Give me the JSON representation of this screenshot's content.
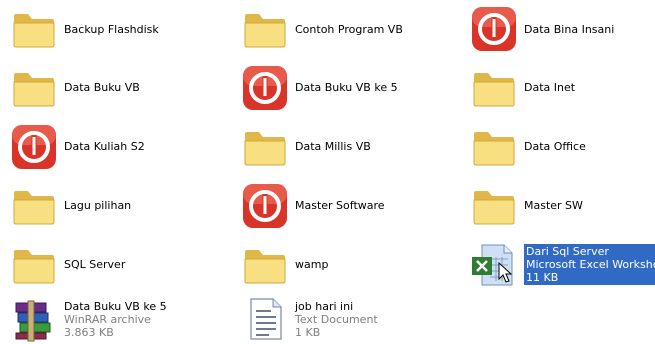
{
  "items": [
    {
      "name": "Backup Flashdisk",
      "icon": "folder-icon"
    },
    {
      "name": "Contoh Program VB",
      "icon": "folder-icon"
    },
    {
      "name": "Data Bina Insani",
      "icon": "red-power-icon"
    },
    {
      "name": "Data Buku VB",
      "icon": "folder-icon"
    },
    {
      "name": "Data Buku VB ke 5",
      "icon": "red-power-icon"
    },
    {
      "name": "Data Inet",
      "icon": "folder-icon"
    },
    {
      "name": "Data Kuliah S2",
      "icon": "red-power-icon"
    },
    {
      "name": "Data Millis VB",
      "icon": "folder-icon"
    },
    {
      "name": "Data Office",
      "icon": "folder-icon"
    },
    {
      "name": "Lagu pilihan",
      "icon": "folder-icon"
    },
    {
      "name": "Master Software",
      "icon": "red-power-icon"
    },
    {
      "name": "Master SW",
      "icon": "folder-icon"
    },
    {
      "name": "SQL Server",
      "icon": "folder-icon"
    },
    {
      "name": "wamp",
      "icon": "folder-icon"
    },
    {
      "name": "Dari Sql Server",
      "type": "Microsoft Excel Worksheet",
      "size": "11 KB",
      "icon": "excel-file-icon",
      "selected": true
    },
    {
      "name": "Data Buku VB ke 5",
      "type": "WinRAR archive",
      "size": "3.863 KB",
      "icon": "winrar-archive-icon"
    },
    {
      "name": "job hari ini",
      "type": "Text Document",
      "size": "1 KB",
      "icon": "text-document-icon"
    }
  ],
  "colors": {
    "selection": "#316ac5",
    "folder": "#f5d867",
    "power_red": "#d9342a",
    "sub_text": "#7f7f7f"
  }
}
